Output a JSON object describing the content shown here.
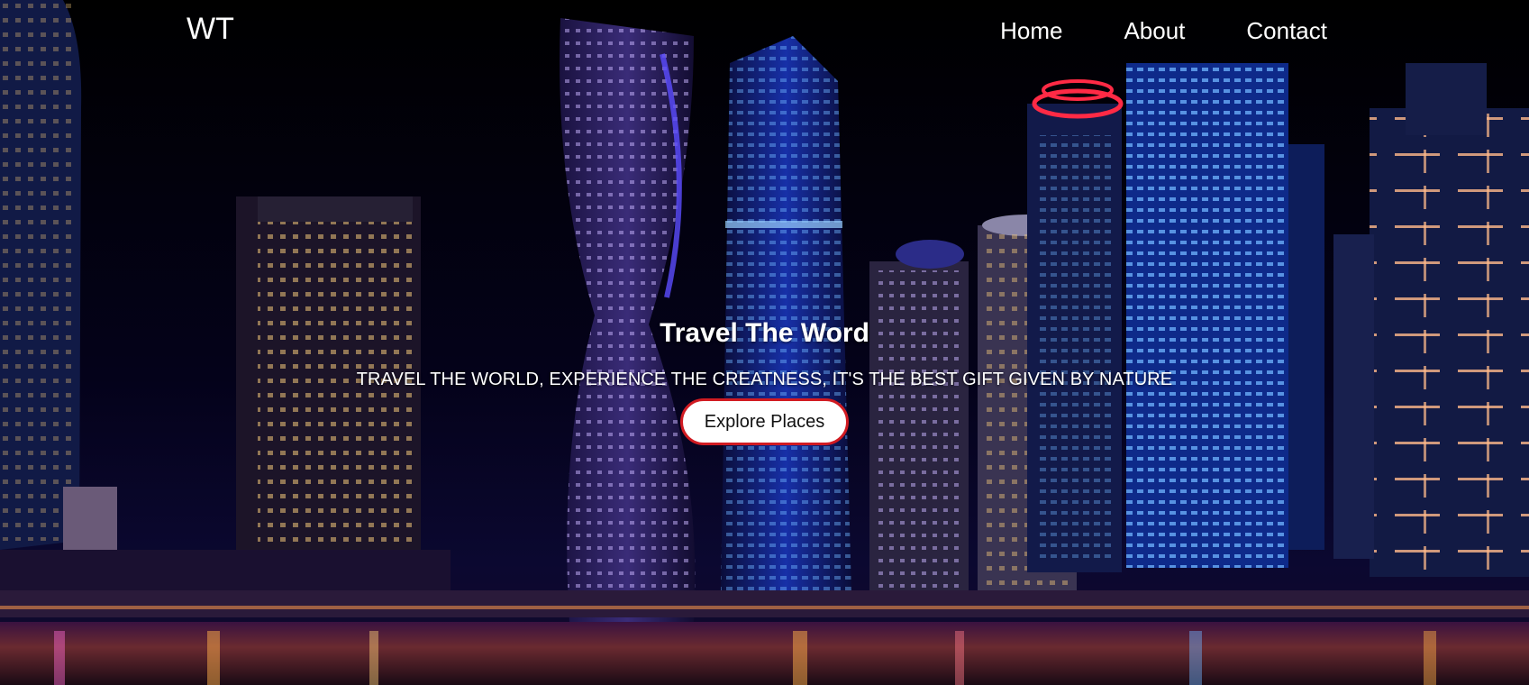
{
  "header": {
    "logo": "WT",
    "nav": [
      {
        "label": "Home"
      },
      {
        "label": "About"
      },
      {
        "label": "Contact"
      }
    ]
  },
  "hero": {
    "title": "Travel The Word",
    "subtitle": "TRAVEL THE WORLD, EXPERIENCE THE CREATNESS, IT'S THE BEST GIFT GIVEN BY NATURE",
    "button_label": "Explore Places",
    "background": "night-city-skyline-with-waterfront"
  },
  "colors": {
    "text": "#ffffff",
    "button_border": "#d11b22",
    "button_bg": "#ffffff"
  }
}
